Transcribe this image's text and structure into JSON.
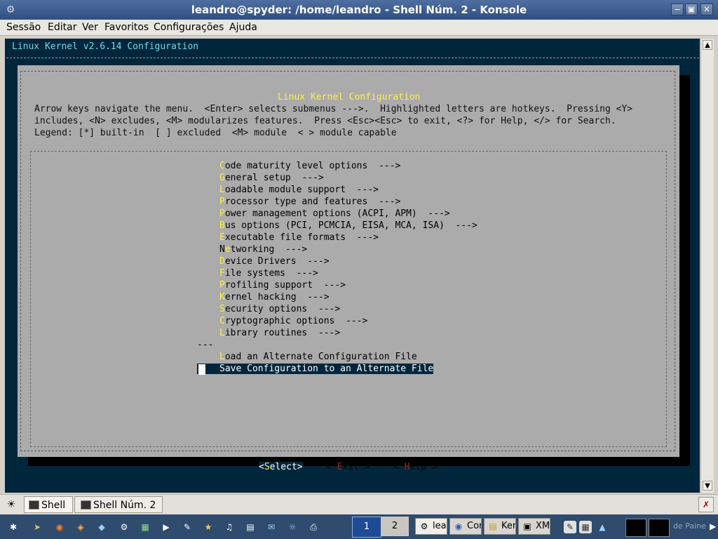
{
  "window": {
    "title": "leandro@spyder: /home/leandro - Shell Núm. 2 - Konsole",
    "menu": [
      "Sessão",
      "Editar",
      "Ver",
      "Favoritos",
      "Configurações",
      "Ajuda"
    ]
  },
  "terminal": {
    "header": "Linux Kernel v2.6.14 Configuration",
    "dialog": {
      "title": "Linux Kernel Configuration",
      "help_lines": [
        "Arrow keys navigate the menu.  <Enter> selects submenus --->.  Highlighted letters are hotkeys.  Pressing <Y>",
        "includes, <N> excludes, <M> modularizes features.  Press <Esc><Esc> to exit, <?> for Help, </> for Search.",
        "Legend: [*] built-in  [ ] excluded  <M> module  < > module capable"
      ],
      "entries": [
        {
          "hotkey": "C",
          "rest": "ode maturity level options  --->"
        },
        {
          "hotkey": "G",
          "rest": "eneral setup  --->"
        },
        {
          "hotkey": "L",
          "rest": "oadable module support  --->"
        },
        {
          "hotkey": "P",
          "rest": "rocessor type and features  --->"
        },
        {
          "hotkey": "P",
          "rest": "ower management options (ACPI, APM)  --->"
        },
        {
          "hotkey": "B",
          "rest": "us options (PCI, PCMCIA, EISA, MCA, ISA)  --->"
        },
        {
          "hotkey": "E",
          "rest": "xecutable file formats  --->"
        },
        {
          "pre": "N",
          "hotkey": "e",
          "rest": "tworking  --->"
        },
        {
          "hotkey": "D",
          "rest": "evice Drivers  --->"
        },
        {
          "hotkey": "F",
          "rest": "ile systems  --->"
        },
        {
          "hotkey": "P",
          "rest": "rofiling support  --->"
        },
        {
          "hotkey": "K",
          "rest": "ernel hacking  --->"
        },
        {
          "hotkey": "S",
          "rest": "ecurity options  --->"
        },
        {
          "hotkey": "C",
          "rest": "ryptographic options  --->"
        },
        {
          "hotkey": "L",
          "rest": "ibrary routines  --->"
        }
      ],
      "separator": "---",
      "load_entry": {
        "hotkey": "L",
        "rest": "oad an Alternate Configuration File"
      },
      "save_entry": "Save Configuration to an Alternate File",
      "buttons": {
        "select": {
          "lb": "<",
          "hk": "S",
          "rest": "elect",
          "rb": ">"
        },
        "exit": {
          "lb": "< ",
          "hk": "E",
          "rest": "xit",
          "rb": " >"
        },
        "help": {
          "lb": "< ",
          "hk": "H",
          "rest": "elp",
          "rb": " >"
        }
      }
    }
  },
  "tabs": [
    "Shell",
    "Shell Núm. 2"
  ],
  "taskbar": {
    "desktops": [
      "1",
      "2"
    ],
    "tasks": [
      "lea",
      "Cor",
      "Ker",
      "XM"
    ],
    "pager_text": "de Paine"
  },
  "colors": {
    "terminal_bg": "#00263b",
    "dialog_bg": "#ababab",
    "hotkey": "#ffee44",
    "header_text": "#6fd9e0"
  }
}
